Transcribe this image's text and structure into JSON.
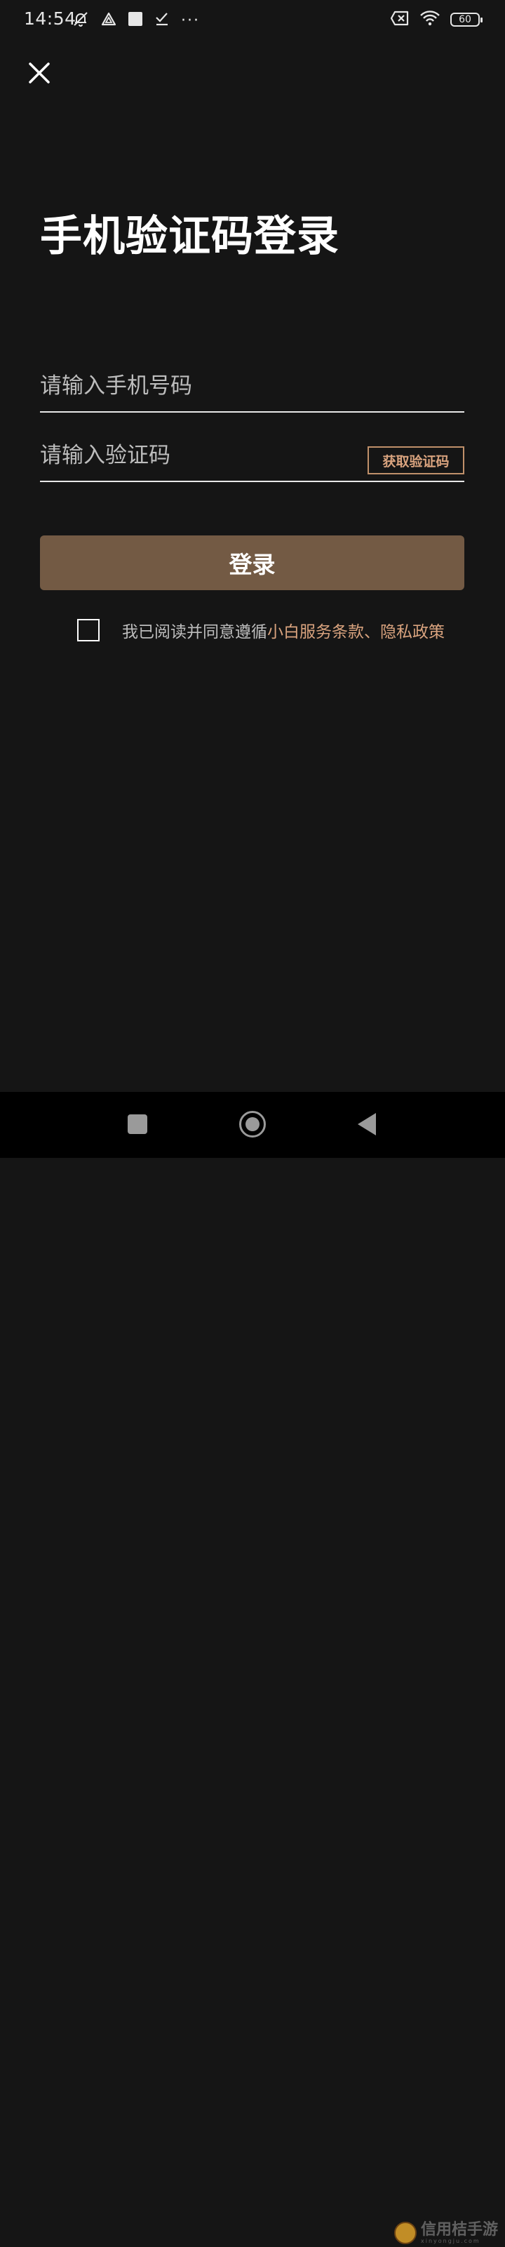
{
  "status_bar": {
    "time": "14:54",
    "more_dots": "···",
    "battery_level": "60"
  },
  "login": {
    "title": "手机验证码登录",
    "phone_placeholder": "请输入手机号码",
    "phone_value": "",
    "code_placeholder": "请输入验证码",
    "code_value": "",
    "get_code_label": "获取验证码",
    "login_label": "登录",
    "agreement_text": "我已阅读并同意遵循",
    "agreement_links": "小白服务条款、隐私政策",
    "agreement_checked": false
  },
  "watermark": {
    "text": "信用桔手游",
    "subtext": "xinyongju.com"
  },
  "colors": {
    "background": "#151515",
    "accent": "#d9a37e",
    "button": "#735a44"
  }
}
